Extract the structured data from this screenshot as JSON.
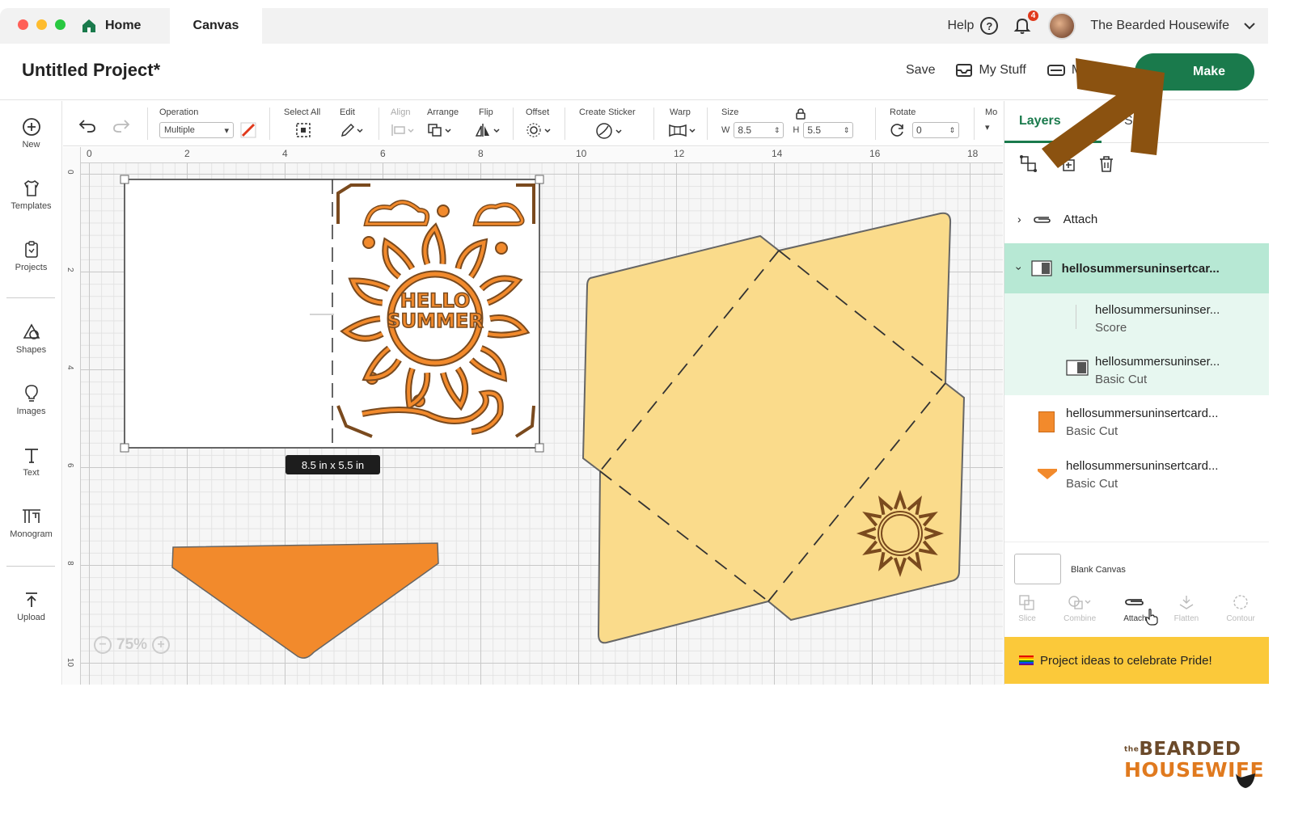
{
  "window": {
    "traffic_colors": [
      "#ff5f57",
      "#febc2e",
      "#28c840"
    ],
    "tabs": [
      {
        "label": "Home"
      },
      {
        "label": "Canvas"
      }
    ],
    "help_label": "Help",
    "notifications_count": "4",
    "user_name": "The Bearded Housewife"
  },
  "project": {
    "title": "Untitled Project*",
    "save_label": "Save",
    "mystuff_label": "My Stuff",
    "machine_label": "M",
    "make_label": "Make"
  },
  "sidebar": {
    "items": [
      {
        "label": "New",
        "icon": "plus-circle-icon"
      },
      {
        "label": "Templates",
        "icon": "shirt-icon"
      },
      {
        "label": "Projects",
        "icon": "projects-icon"
      },
      {
        "label": "Shapes",
        "icon": "shapes-icon"
      },
      {
        "label": "Images",
        "icon": "lightbulb-icon"
      },
      {
        "label": "Text",
        "icon": "text-icon"
      },
      {
        "label": "Monogram",
        "icon": "monogram-icon"
      },
      {
        "label": "Upload",
        "icon": "upload-icon"
      }
    ]
  },
  "toolbar": {
    "operation_label": "Operation",
    "operation_value": "Multiple",
    "select_all_label": "Select All",
    "edit_label": "Edit",
    "align_label": "Align",
    "arrange_label": "Arrange",
    "flip_label": "Flip",
    "offset_label": "Offset",
    "create_sticker_label": "Create Sticker",
    "warp_label": "Warp",
    "size_label": "Size",
    "w_label": "W",
    "w_value": "8.5",
    "h_label": "H",
    "h_value": "5.5",
    "rotate_label": "Rotate",
    "rotate_value": "0",
    "more_label": "Mo"
  },
  "canvas": {
    "ruler_top": [
      "0",
      "2",
      "4",
      "6",
      "8",
      "10",
      "12",
      "14",
      "16",
      "18"
    ],
    "ruler_left": [
      "0",
      "2",
      "4",
      "6",
      "8",
      "10"
    ],
    "size_tooltip": "8.5  in x 5.5  in",
    "card_text_line1": "HELLO",
    "card_text_line2": "SUMMER",
    "zoom_label": "75%",
    "colors": {
      "orange": "#f28a2c",
      "envelope": "#fadb8b",
      "outline": "#7a4a1e",
      "arrow": "#8b5210"
    }
  },
  "layers_panel": {
    "tab_layers": "Layers",
    "tab_other": "S",
    "attach_group": "Attach",
    "rows": [
      {
        "name": "hellosummersuninsertcar...",
        "type": ""
      },
      {
        "name": "hellosummersuninser...",
        "type": "Score"
      },
      {
        "name": "hellosummersuninser...",
        "type": "Basic Cut"
      },
      {
        "name": "hellosummersuninsertcard...",
        "type": "Basic Cut"
      },
      {
        "name": "hellosummersuninsertcard...",
        "type": "Basic Cut"
      }
    ],
    "blank_canvas_label": "Blank Canvas",
    "tools": [
      {
        "label": "Slice"
      },
      {
        "label": "Combine"
      },
      {
        "label": "Attach"
      },
      {
        "label": "Flatten"
      },
      {
        "label": "Contour"
      }
    ],
    "banner_text": "Project ideas to celebrate Pride!"
  },
  "logo": {
    "small_prefix": "the",
    "top": "BEARDED",
    "bottom": "HOUSEWIFE"
  }
}
